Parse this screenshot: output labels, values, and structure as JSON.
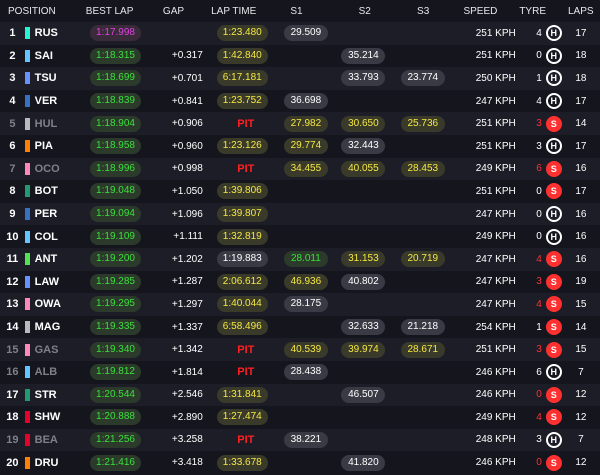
{
  "header": {
    "position": "POSITION",
    "best_lap": "BEST LAP",
    "gap": "GAP",
    "lap_time": "LAP TIME",
    "s1": "S1",
    "s2": "S2",
    "s3": "S3",
    "speed": "SPEED",
    "tyre": "TYRE",
    "laps": "LAPS"
  },
  "rows": [
    {
      "pos": "1",
      "team_color": "#27f4d2",
      "driver": "RUS",
      "best": "1:17.998",
      "best_class": "purple",
      "gap": "",
      "lap": "1:23.480",
      "lap_class": "yellow",
      "s1": "29.509",
      "s1_class": "white",
      "s2": "",
      "s2_class": "",
      "s3": "",
      "s3_class": "",
      "speed": "251 KPH",
      "tyre_count": "4",
      "tyre_count_red": false,
      "tyre": "H",
      "laps": "17",
      "dim": false
    },
    {
      "pos": "2",
      "team_color": "#64c4ff",
      "driver": "SAI",
      "best": "1:18.315",
      "best_class": "green",
      "gap": "+0.317",
      "lap": "1:42.840",
      "lap_class": "yellow",
      "s1": "",
      "s1_class": "",
      "s2": "35.214",
      "s2_class": "white",
      "s3": "",
      "s3_class": "",
      "speed": "251 KPH",
      "tyre_count": "0",
      "tyre_count_red": false,
      "tyre": "H",
      "laps": "18",
      "dim": false
    },
    {
      "pos": "3",
      "team_color": "#6692ff",
      "driver": "TSU",
      "best": "1:18.699",
      "best_class": "green",
      "gap": "+0.701",
      "lap": "6:17.181",
      "lap_class": "yellow",
      "s1": "",
      "s1_class": "",
      "s2": "33.793",
      "s2_class": "white",
      "s3": "23.774",
      "s3_class": "white",
      "speed": "250 KPH",
      "tyre_count": "1",
      "tyre_count_red": false,
      "tyre": "H",
      "laps": "18",
      "dim": false
    },
    {
      "pos": "4",
      "team_color": "#3671c6",
      "driver": "VER",
      "best": "1:18.839",
      "best_class": "green",
      "gap": "+0.841",
      "lap": "1:23.752",
      "lap_class": "yellow",
      "s1": "36.698",
      "s1_class": "white",
      "s2": "",
      "s2_class": "",
      "s3": "",
      "s3_class": "",
      "speed": "247 KPH",
      "tyre_count": "4",
      "tyre_count_red": false,
      "tyre": "H",
      "laps": "17",
      "dim": false
    },
    {
      "pos": "5",
      "team_color": "#b6babd",
      "driver": "HUL",
      "best": "1:18.904",
      "best_class": "green",
      "gap": "+0.906",
      "lap": "PIT",
      "lap_class": "pit",
      "s1": "27.982",
      "s1_class": "yellow",
      "s2": "30.650",
      "s2_class": "yellow",
      "s3": "25.736",
      "s3_class": "yellow",
      "speed": "251 KPH",
      "tyre_count": "3",
      "tyre_count_red": true,
      "tyre": "S",
      "laps": "14",
      "dim": true
    },
    {
      "pos": "6",
      "team_color": "#ff8000",
      "driver": "PIA",
      "best": "1:18.958",
      "best_class": "green",
      "gap": "+0.960",
      "lap": "1:23.126",
      "lap_class": "yellow",
      "s1": "29.774",
      "s1_class": "yellow",
      "s2": "32.443",
      "s2_class": "white",
      "s3": "",
      "s3_class": "",
      "speed": "251 KPH",
      "tyre_count": "3",
      "tyre_count_red": false,
      "tyre": "H",
      "laps": "17",
      "dim": false
    },
    {
      "pos": "7",
      "team_color": "#ff87bc",
      "driver": "OCO",
      "best": "1:18.996",
      "best_class": "green",
      "gap": "+0.998",
      "lap": "PIT",
      "lap_class": "pit",
      "s1": "34.455",
      "s1_class": "yellow",
      "s2": "40.055",
      "s2_class": "yellow",
      "s3": "28.453",
      "s3_class": "yellow",
      "speed": "249 KPH",
      "tyre_count": "6",
      "tyre_count_red": true,
      "tyre": "S",
      "laps": "16",
      "dim": true
    },
    {
      "pos": "8",
      "team_color": "#229971",
      "driver": "BOT",
      "best": "1:19.048",
      "best_class": "green",
      "gap": "+1.050",
      "lap": "1:39.806",
      "lap_class": "yellow",
      "s1": "",
      "s1_class": "",
      "s2": "",
      "s2_class": "",
      "s3": "",
      "s3_class": "",
      "speed": "251 KPH",
      "tyre_count": "0",
      "tyre_count_red": false,
      "tyre": "S",
      "laps": "17",
      "dim": false
    },
    {
      "pos": "9",
      "team_color": "#3671c6",
      "driver": "PER",
      "best": "1:19.094",
      "best_class": "green",
      "gap": "+1.096",
      "lap": "1:39.807",
      "lap_class": "yellow",
      "s1": "",
      "s1_class": "",
      "s2": "",
      "s2_class": "",
      "s3": "",
      "s3_class": "",
      "speed": "247 KPH",
      "tyre_count": "0",
      "tyre_count_red": false,
      "tyre": "H",
      "laps": "16",
      "dim": false
    },
    {
      "pos": "10",
      "team_color": "#64c4ff",
      "driver": "COL",
      "best": "1:19.109",
      "best_class": "green",
      "gap": "+1.111",
      "lap": "1:32.819",
      "lap_class": "yellow",
      "s1": "",
      "s1_class": "",
      "s2": "",
      "s2_class": "",
      "s3": "",
      "s3_class": "",
      "speed": "249 KPH",
      "tyre_count": "0",
      "tyre_count_red": false,
      "tyre": "H",
      "laps": "16",
      "dim": false
    },
    {
      "pos": "11",
      "team_color": "#52e252",
      "driver": "ANT",
      "best": "1:19.200",
      "best_class": "green",
      "gap": "+1.202",
      "lap": "1:19.883",
      "lap_class": "white",
      "s1": "28.011",
      "s1_class": "green",
      "s2": "31.153",
      "s2_class": "yellow",
      "s3": "20.719",
      "s3_class": "yellow",
      "speed": "247 KPH",
      "tyre_count": "4",
      "tyre_count_red": true,
      "tyre": "S",
      "laps": "16",
      "dim": false
    },
    {
      "pos": "12",
      "team_color": "#6692ff",
      "driver": "LAW",
      "best": "1:19.285",
      "best_class": "green",
      "gap": "+1.287",
      "lap": "2:06.612",
      "lap_class": "yellow",
      "s1": "46.936",
      "s1_class": "yellow",
      "s2": "40.802",
      "s2_class": "white",
      "s3": "",
      "s3_class": "",
      "speed": "247 KPH",
      "tyre_count": "3",
      "tyre_count_red": true,
      "tyre": "S",
      "laps": "19",
      "dim": false
    },
    {
      "pos": "13",
      "team_color": "#ff87bc",
      "driver": "OWA",
      "best": "1:19.295",
      "best_class": "green",
      "gap": "+1.297",
      "lap": "1:40.044",
      "lap_class": "yellow",
      "s1": "28.175",
      "s1_class": "white",
      "s2": "",
      "s2_class": "",
      "s3": "",
      "s3_class": "",
      "speed": "247 KPH",
      "tyre_count": "4",
      "tyre_count_red": true,
      "tyre": "S",
      "laps": "15",
      "dim": false
    },
    {
      "pos": "14",
      "team_color": "#b6babd",
      "driver": "MAG",
      "best": "1:19.335",
      "best_class": "green",
      "gap": "+1.337",
      "lap": "6:58.496",
      "lap_class": "yellow",
      "s1": "",
      "s1_class": "",
      "s2": "32.633",
      "s2_class": "white",
      "s3": "21.218",
      "s3_class": "white",
      "speed": "254 KPH",
      "tyre_count": "1",
      "tyre_count_red": false,
      "tyre": "S",
      "laps": "14",
      "dim": false
    },
    {
      "pos": "15",
      "team_color": "#ff87bc",
      "driver": "GAS",
      "best": "1:19.340",
      "best_class": "green",
      "gap": "+1.342",
      "lap": "PIT",
      "lap_class": "pit",
      "s1": "40.539",
      "s1_class": "yellow",
      "s2": "39.974",
      "s2_class": "yellow",
      "s3": "28.671",
      "s3_class": "yellow",
      "speed": "251 KPH",
      "tyre_count": "3",
      "tyre_count_red": true,
      "tyre": "S",
      "laps": "15",
      "dim": true
    },
    {
      "pos": "16",
      "team_color": "#64c4ff",
      "driver": "ALB",
      "best": "1:19.812",
      "best_class": "green",
      "gap": "+1.814",
      "lap": "PIT",
      "lap_class": "pit",
      "s1": "28.438",
      "s1_class": "white",
      "s2": "",
      "s2_class": "",
      "s3": "",
      "s3_class": "",
      "speed": "246 KPH",
      "tyre_count": "6",
      "tyre_count_red": false,
      "tyre": "H",
      "laps": "7",
      "dim": true
    },
    {
      "pos": "17",
      "team_color": "#229971",
      "driver": "STR",
      "best": "1:20.544",
      "best_class": "green",
      "gap": "+2.546",
      "lap": "1:31.841",
      "lap_class": "yellow",
      "s1": "",
      "s1_class": "",
      "s2": "46.507",
      "s2_class": "white",
      "s3": "",
      "s3_class": "",
      "speed": "246 KPH",
      "tyre_count": "0",
      "tyre_count_red": true,
      "tyre": "S",
      "laps": "12",
      "dim": false
    },
    {
      "pos": "18",
      "team_color": "#e8002d",
      "driver": "SHW",
      "best": "1:20.888",
      "best_class": "green",
      "gap": "+2.890",
      "lap": "1:27.474",
      "lap_class": "yellow",
      "s1": "",
      "s1_class": "",
      "s2": "",
      "s2_class": "",
      "s3": "",
      "s3_class": "",
      "speed": "249 KPH",
      "tyre_count": "4",
      "tyre_count_red": true,
      "tyre": "S",
      "laps": "12",
      "dim": false
    },
    {
      "pos": "19",
      "team_color": "#e8002d",
      "driver": "BEA",
      "best": "1:21.256",
      "best_class": "green",
      "gap": "+3.258",
      "lap": "PIT",
      "lap_class": "pit",
      "s1": "38.221",
      "s1_class": "white",
      "s2": "",
      "s2_class": "",
      "s3": "",
      "s3_class": "",
      "speed": "248 KPH",
      "tyre_count": "3",
      "tyre_count_red": false,
      "tyre": "H",
      "laps": "7",
      "dim": true
    },
    {
      "pos": "20",
      "team_color": "#ff8000",
      "driver": "DRU",
      "best": "1:21.416",
      "best_class": "green",
      "gap": "+3.418",
      "lap": "1:33.678",
      "lap_class": "yellow",
      "s1": "",
      "s1_class": "",
      "s2": "41.820",
      "s2_class": "white",
      "s3": "",
      "s3_class": "",
      "speed": "246 KPH",
      "tyre_count": "0",
      "tyre_count_red": true,
      "tyre": "S",
      "laps": "12",
      "dim": false
    }
  ]
}
